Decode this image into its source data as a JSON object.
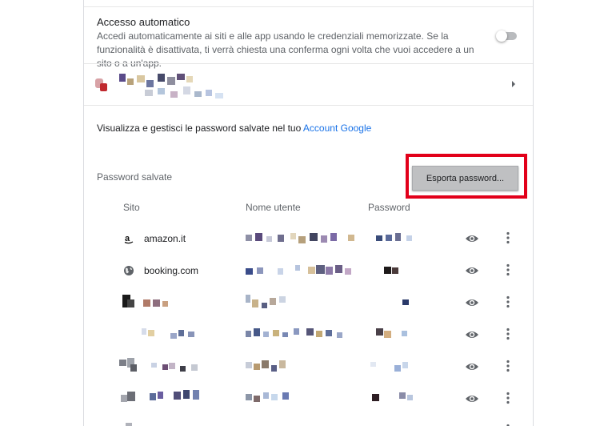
{
  "autosignin": {
    "title": "Accesso automatico",
    "description": "Accedi automaticamente ai siti e alle app usando le credenziali memorizzate. Se la funzionalità è disattivata, ti verrà chiesta una conferma ogni volta che vuoi accedere a un sito o a un'app.",
    "enabled": false
  },
  "account_info": {
    "text": "Visualizza e gestisci le password salvate nel tuo ",
    "link": "Account Google"
  },
  "saved_passwords": {
    "title": "Password salvate",
    "export_label": "Esporta password..."
  },
  "columns": {
    "site": "Sito",
    "username": "Nome utente",
    "password": "Password"
  },
  "rows": [
    {
      "site": "amazon.it",
      "icon": "amazon-icon"
    },
    {
      "site": "booking.com",
      "icon": "globe-icon"
    },
    {
      "site": "",
      "icon": "redacted-icon"
    },
    {
      "site": "",
      "icon": "redacted-icon"
    },
    {
      "site": "",
      "icon": "redacted-icon"
    },
    {
      "site": "",
      "icon": "redacted-icon"
    }
  ],
  "colors": {
    "link": "#1a73e8",
    "highlight": "#e2001a"
  }
}
